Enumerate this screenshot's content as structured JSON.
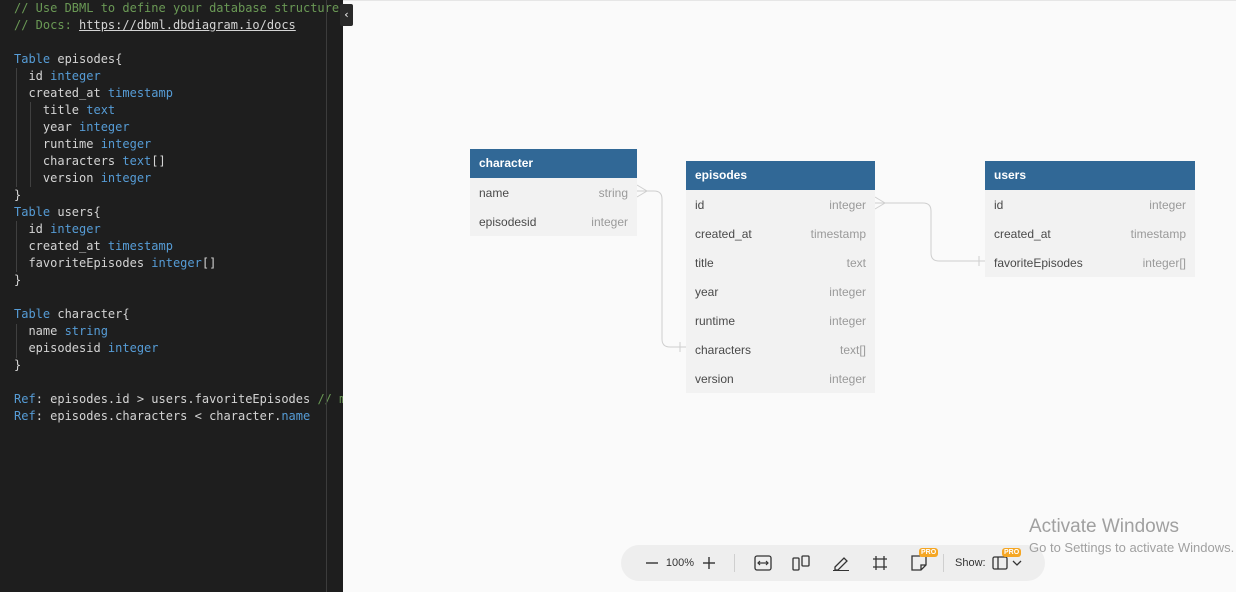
{
  "editor": {
    "lines": [
      {
        "tokens": [
          {
            "text": "// Use DBML to define your database structure",
            "style": "c"
          }
        ]
      },
      {
        "tokens": [
          {
            "text": "// Docs: ",
            "style": "c"
          },
          {
            "text": "https://dbml.dbdiagram.io/docs",
            "style": "link"
          }
        ]
      },
      {
        "tokens": []
      },
      {
        "tokens": [
          {
            "text": "Table",
            "style": "k"
          },
          {
            "text": " episodes{",
            "style": ""
          }
        ]
      },
      {
        "tokens": [
          {
            "text": "  id ",
            "style": ""
          },
          {
            "text": "integer",
            "style": "t"
          }
        ]
      },
      {
        "tokens": [
          {
            "text": "  created_at ",
            "style": ""
          },
          {
            "text": "timestamp",
            "style": "t"
          }
        ]
      },
      {
        "tokens": [
          {
            "text": "    title ",
            "style": ""
          },
          {
            "text": "text",
            "style": "t"
          }
        ]
      },
      {
        "tokens": [
          {
            "text": "    year ",
            "style": ""
          },
          {
            "text": "integer",
            "style": "t"
          }
        ]
      },
      {
        "tokens": [
          {
            "text": "    runtime ",
            "style": ""
          },
          {
            "text": "integer",
            "style": "t"
          }
        ]
      },
      {
        "tokens": [
          {
            "text": "    characters ",
            "style": ""
          },
          {
            "text": "text",
            "style": "t"
          },
          {
            "text": "[]",
            "style": ""
          }
        ]
      },
      {
        "tokens": [
          {
            "text": "    version ",
            "style": ""
          },
          {
            "text": "integer",
            "style": "t"
          }
        ]
      },
      {
        "tokens": [
          {
            "text": "}",
            "style": ""
          }
        ]
      },
      {
        "tokens": [
          {
            "text": "Table",
            "style": "k"
          },
          {
            "text": " users{",
            "style": ""
          }
        ]
      },
      {
        "tokens": [
          {
            "text": "  id ",
            "style": ""
          },
          {
            "text": "integer",
            "style": "t"
          }
        ]
      },
      {
        "tokens": [
          {
            "text": "  created_at ",
            "style": ""
          },
          {
            "text": "timestamp",
            "style": "t"
          }
        ]
      },
      {
        "tokens": [
          {
            "text": "  favoriteEpisodes ",
            "style": ""
          },
          {
            "text": "integer",
            "style": "t"
          },
          {
            "text": "[]",
            "style": ""
          }
        ]
      },
      {
        "tokens": [
          {
            "text": "}",
            "style": ""
          }
        ]
      },
      {
        "tokens": []
      },
      {
        "tokens": [
          {
            "text": "Table",
            "style": "k"
          },
          {
            "text": " character{",
            "style": ""
          }
        ]
      },
      {
        "tokens": [
          {
            "text": "  name ",
            "style": ""
          },
          {
            "text": "string",
            "style": "t"
          }
        ]
      },
      {
        "tokens": [
          {
            "text": "  episodesid ",
            "style": ""
          },
          {
            "text": "integer",
            "style": "t"
          }
        ]
      },
      {
        "tokens": [
          {
            "text": "}",
            "style": ""
          }
        ]
      },
      {
        "tokens": []
      },
      {
        "tokens": [
          {
            "text": "Ref",
            "style": "k"
          },
          {
            "text": ": episodes.id > users.favoriteEpisodes ",
            "style": ""
          },
          {
            "text": "// ma",
            "style": "c"
          }
        ]
      },
      {
        "tokens": [
          {
            "text": "Ref",
            "style": "k"
          },
          {
            "text": ": episodes.characters < character.",
            "style": ""
          },
          {
            "text": "name",
            "style": "t"
          }
        ]
      }
    ]
  },
  "colors": {
    "table_header": "#316896",
    "editor_bg": "#1e1e1e",
    "keyword": "#569cd6",
    "comment": "#6a9955",
    "pro_badge": "#f5a623"
  },
  "diagram": {
    "tables": {
      "character": {
        "name": "character",
        "fields": [
          {
            "name": "name",
            "type": "string"
          },
          {
            "name": "episodesid",
            "type": "integer"
          }
        ]
      },
      "episodes": {
        "name": "episodes",
        "fields": [
          {
            "name": "id",
            "type": "integer"
          },
          {
            "name": "created_at",
            "type": "timestamp"
          },
          {
            "name": "title",
            "type": "text"
          },
          {
            "name": "year",
            "type": "integer"
          },
          {
            "name": "runtime",
            "type": "integer"
          },
          {
            "name": "characters",
            "type": "text[]"
          },
          {
            "name": "version",
            "type": "integer"
          }
        ]
      },
      "users": {
        "name": "users",
        "fields": [
          {
            "name": "id",
            "type": "integer"
          },
          {
            "name": "created_at",
            "type": "timestamp"
          },
          {
            "name": "favoriteEpisodes",
            "type": "integer[]"
          }
        ]
      }
    }
  },
  "toolbar": {
    "zoom": "100%",
    "zoom_out_icon": "minus-icon",
    "zoom_in_icon": "plus-icon",
    "show_label": "Show:",
    "pro_badge": "PRO"
  },
  "watermark": {
    "title": "Activate Windows",
    "subtitle": "Go to Settings to activate Windows."
  }
}
